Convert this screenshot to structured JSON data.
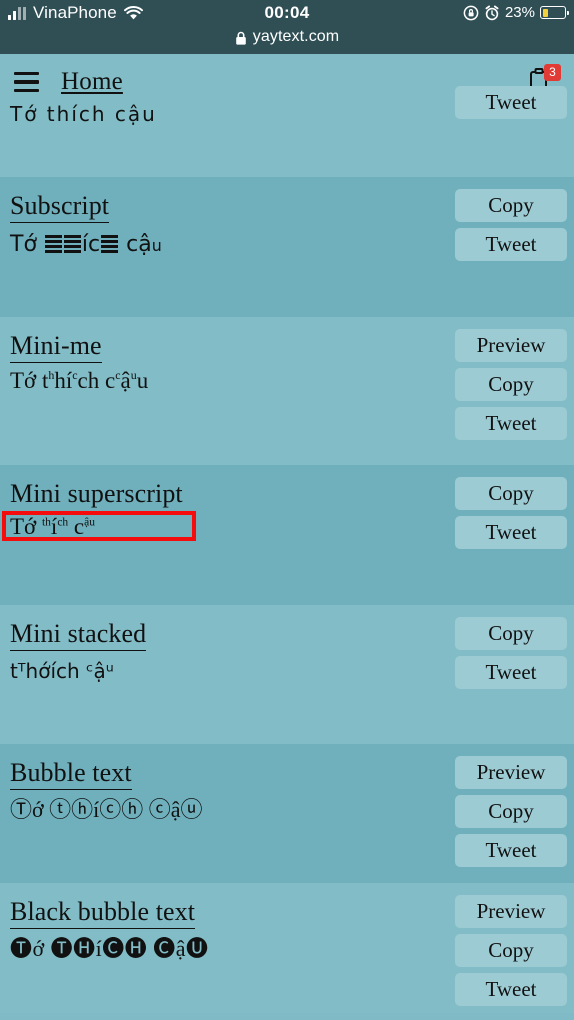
{
  "status_bar": {
    "carrier": "VinaPhone",
    "signal_icon": "signal-bars-icon",
    "wifi_icon": "wifi-icon",
    "time": "00:04",
    "rotation_lock_icon": "rotation-lock-icon",
    "alarm_icon": "alarm-clock-icon",
    "battery_percent": "23%",
    "battery_icon": "battery-icon",
    "battery_level": 23,
    "battery_color": "#f4d03f",
    "lock_icon": "lock-icon",
    "url": "yaytext.com",
    "background": "#2f4f55"
  },
  "navbar": {
    "menu_icon": "hamburger-menu-icon",
    "home_label": "Home",
    "clipboard_icon": "clipboard-icon",
    "clipboard_badge": "3",
    "badge_color": "#e03b34",
    "background": "#82bdc7"
  },
  "theme": {
    "band_light": "#82bdc7",
    "band_dark": "#6fb0bc",
    "button_bg": "#9ccbd3",
    "highlight_border": "#f50d0d"
  },
  "sections": [
    {
      "id": "partial-top",
      "title": "",
      "underlined": false,
      "sample": "Tớ thích cậu",
      "buttons": [
        "Tweet"
      ],
      "band": "light"
    },
    {
      "id": "subscript",
      "title": "Subscript",
      "underlined": true,
      "sample": "Tớ thích cậu",
      "buttons": [
        "Copy",
        "Tweet"
      ],
      "band": "dark"
    },
    {
      "id": "mini-me",
      "title": "Mini-me",
      "underlined": true,
      "sample": "Tớ thích cậu",
      "buttons": [
        "Preview",
        "Copy",
        "Tweet"
      ],
      "band": "light"
    },
    {
      "id": "mini-superscript",
      "title": "Mini superscript",
      "underlined": false,
      "sample": "Tớ thích cậu",
      "buttons": [
        "Copy",
        "Tweet"
      ],
      "band": "dark",
      "highlighted": true
    },
    {
      "id": "mini-stacked",
      "title": "Mini stacked",
      "underlined": true,
      "sample": "tᵀhớích ᶜậᵘ",
      "buttons": [
        "Copy",
        "Tweet"
      ],
      "band": "light"
    },
    {
      "id": "bubble-text",
      "title": "Bubble text",
      "underlined": true,
      "sample": "Ⓣớ ⓣⓗíⓒⓗ ⓒậⓤ",
      "buttons": [
        "Preview",
        "Copy",
        "Tweet"
      ],
      "band": "dark"
    },
    {
      "id": "black-bubble-text",
      "title": "Black bubble text",
      "underlined": true,
      "sample": "🅣ớ 🅣🅗í🅒🅗 🅒ậ🅤",
      "buttons": [
        "Preview",
        "Copy",
        "Tweet"
      ],
      "band": "light"
    }
  ]
}
